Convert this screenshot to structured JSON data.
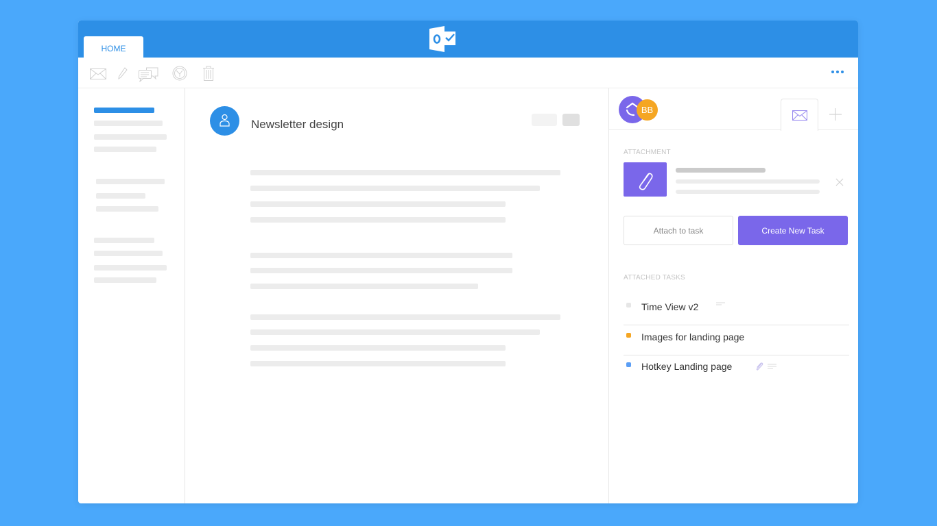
{
  "ribbon": {
    "tab_label": "HOME",
    "logo": "outlook-logo"
  },
  "toolbar": {
    "icons": [
      "mail-icon",
      "pencil-icon",
      "chat-icon",
      "clock-icon",
      "trash-icon"
    ],
    "more": "more-icon"
  },
  "email": {
    "subject": "Newsletter design"
  },
  "panel": {
    "avatar_initials": "BB",
    "attachment_label": "ATTACHMENT",
    "attach_button": "Attach to task",
    "create_button": "Create New Task",
    "attached_tasks_label": "ATTACHED TASKS",
    "tasks": [
      {
        "name": "Time View v2",
        "color": "#e6e6e6",
        "has_attachment": false,
        "has_notes": true
      },
      {
        "name": "Images for landing page",
        "color": "#f5a623",
        "has_attachment": false,
        "has_notes": false
      },
      {
        "name": "Hotkey Landing page",
        "color": "#5b9ef5",
        "has_attachment": true,
        "has_notes": true
      }
    ]
  },
  "colors": {
    "ribbon": "#2d8fe6",
    "accent": "#7a67ea",
    "background": "#4aa8fb",
    "orange": "#f5a623"
  }
}
